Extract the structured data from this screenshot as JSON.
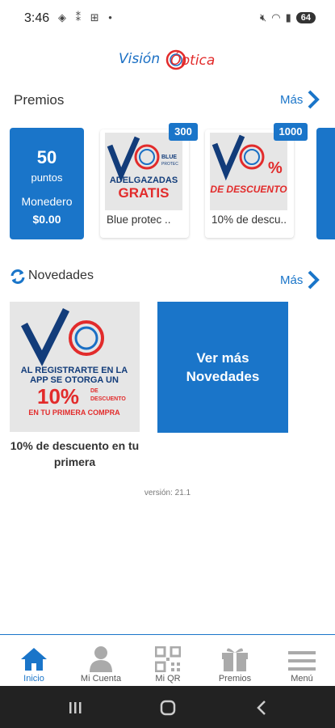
{
  "status": {
    "time": "3:46",
    "battery": "64"
  },
  "brand": {
    "logo_part1": "Visión",
    "logo_part2": "Óptica"
  },
  "rewards": {
    "title": "Premios",
    "more_label": "Más",
    "points_value": "50",
    "points_label": "puntos",
    "wallet_label": "Monedero",
    "wallet_value": "$0.00",
    "items": [
      {
        "badge": "300",
        "caption": "Blue protec ..",
        "art_line1": "BLUE",
        "art_line2": "PROTEC",
        "art_line3": "ADELGAZADAS",
        "art_line4": "GRATIS"
      },
      {
        "badge": "1000",
        "caption": "10% de descu..",
        "art_pct": "%",
        "art_line": "DE DESCUENTO"
      }
    ]
  },
  "news": {
    "title": "Novedades",
    "more_label": "Más",
    "item_caption": "10% de descuento en tu primera",
    "art_line1": "AL REGISTRARTE EN LA",
    "art_line2": "APP SE OTORGA UN",
    "art_pct": "10%",
    "art_de": "DE",
    "art_desc": "DESCUENTO",
    "art_line3": "EN TU PRIMERA COMPRA",
    "see_more": "Ver más Novedades"
  },
  "version": "versión: 21.1",
  "nav": [
    {
      "label": "Inicio",
      "icon": "home-icon"
    },
    {
      "label": "Mi Cuenta",
      "icon": "user-icon"
    },
    {
      "label": "Mi QR",
      "icon": "qr-icon"
    },
    {
      "label": "Premios",
      "icon": "gift-icon"
    },
    {
      "label": "Menú",
      "icon": "menu-icon"
    }
  ],
  "colors": {
    "accent": "#1a75c9",
    "brand_red": "#e22b2b"
  }
}
